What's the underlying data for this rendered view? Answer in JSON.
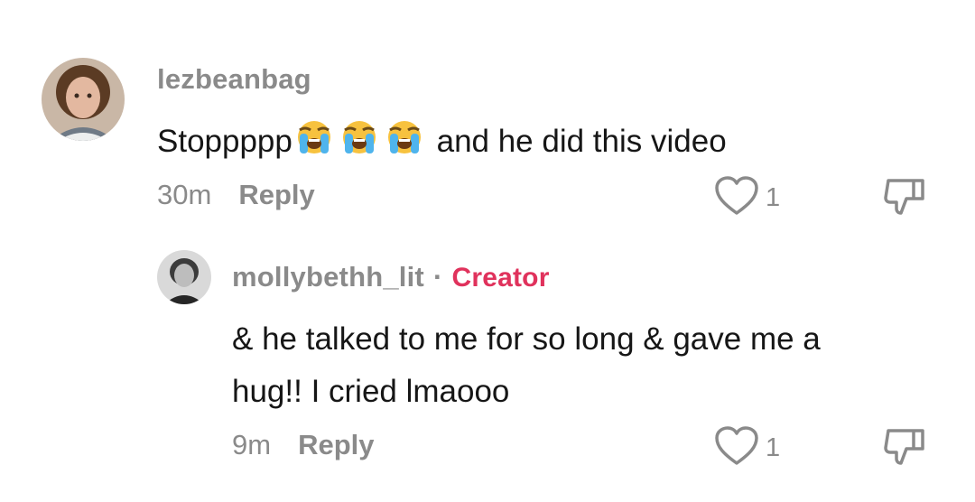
{
  "comments": [
    {
      "username": "lezbeanbag",
      "text_before_emoji": "Stoppppp",
      "emoji_name": "loudly-crying-face-emoji",
      "emoji_count": 3,
      "text_after_emoji": " and he did this video",
      "time": "30m",
      "reply_label": "Reply",
      "like_count": "1"
    },
    {
      "username": "mollybethh_lit",
      "separator": "·",
      "badge": "Creator",
      "badge_color": "#e0325c",
      "text": "& he talked to me for so long & gave me a hug!! I cried lmaooo",
      "time": "9m",
      "reply_label": "Reply",
      "like_count": "1"
    }
  ],
  "colors": {
    "muted": "#8a8a8a",
    "text": "#161616",
    "background": "#ffffff"
  }
}
